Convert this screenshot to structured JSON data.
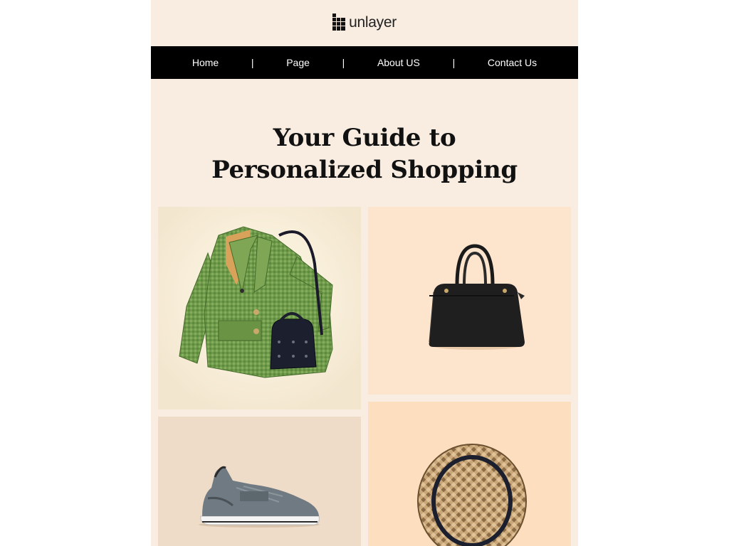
{
  "brand": {
    "logo_icon": "unlayer-logo-icon",
    "name": "unlayer"
  },
  "nav": {
    "items": [
      {
        "label": "Home"
      },
      {
        "label": "Page"
      },
      {
        "label": "About US"
      },
      {
        "label": "Contact Us"
      }
    ],
    "separator": "|"
  },
  "hero": {
    "title_line1": "Your Guide to",
    "title_line2": "Personalized Shopping"
  },
  "products": [
    {
      "icon": "green-jacket-with-bag-image"
    },
    {
      "icon": "black-handbag-image"
    },
    {
      "icon": "grey-sneaker-image"
    },
    {
      "icon": "straw-fedora-hat-image"
    }
  ],
  "colors": {
    "page_bg": "#f9ede1",
    "nav_bg": "#000000",
    "nav_text": "#ffffff",
    "title": "#111111"
  }
}
